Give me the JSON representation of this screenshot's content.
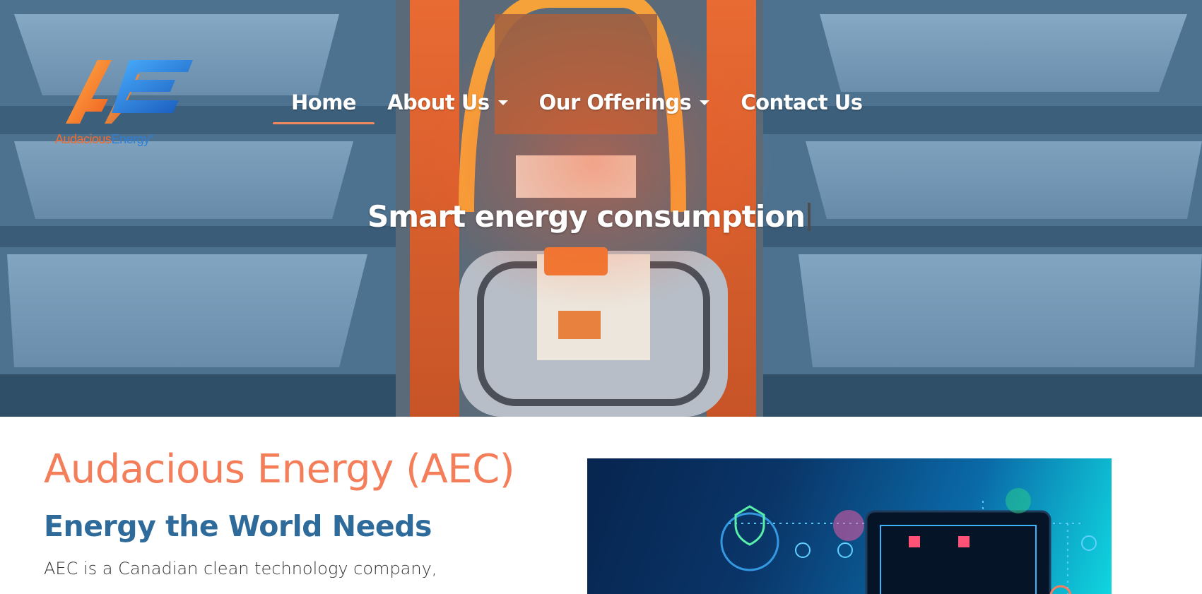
{
  "brand": {
    "logo_word_1": "Audacious",
    "logo_word_2": "Energy",
    "logo_mark": "®",
    "colors": {
      "orange": "#f26b2c",
      "blue": "#2f7fd6",
      "title_orange": "#f47d5a",
      "subtitle_blue": "#2f6b9a"
    }
  },
  "nav": {
    "items": [
      {
        "label": "Home",
        "active": true
      },
      {
        "label": "About Us",
        "has_dropdown": true
      },
      {
        "label": "Our Offerings",
        "has_dropdown": true
      },
      {
        "label": "Contact Us"
      }
    ]
  },
  "hero": {
    "headline": "Smart energy consumption"
  },
  "content": {
    "title": "Audacious Energy (AEC)",
    "subtitle": "Energy the World Needs",
    "body": "AEC is a Canadian clean technology company,"
  },
  "icons": {
    "caret": "chevron-down-icon",
    "shield": "shield-icon"
  }
}
